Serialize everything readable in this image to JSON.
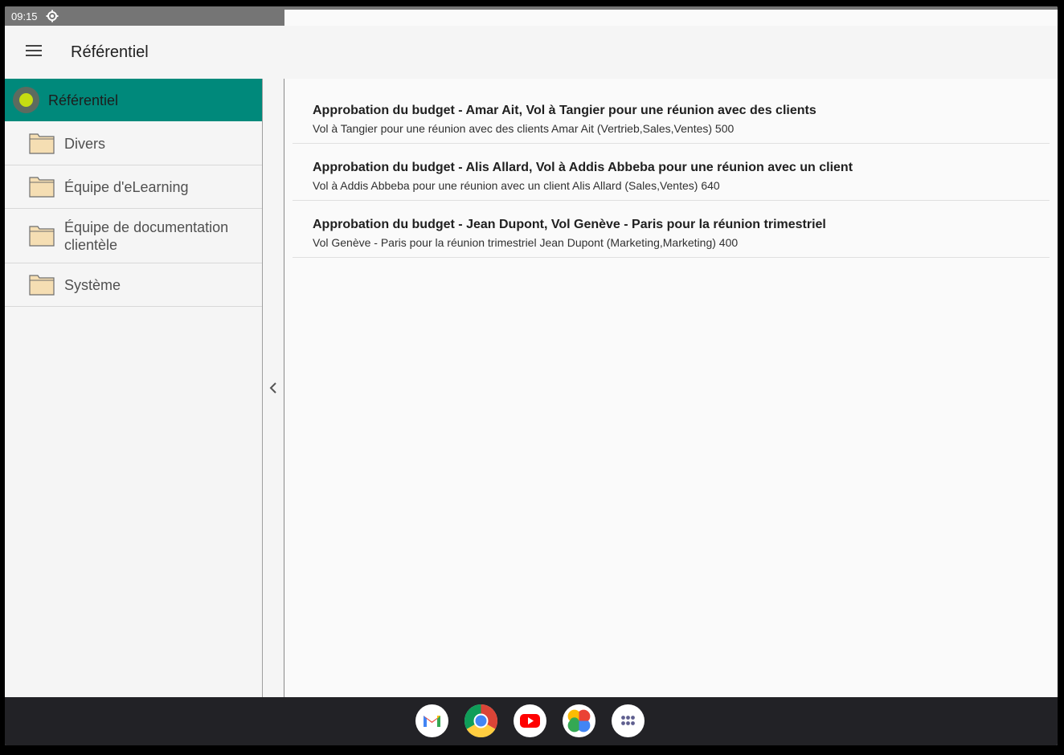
{
  "status": {
    "time": "09:15"
  },
  "appbar": {
    "title": "Référentiel"
  },
  "tree": {
    "root": "Référentiel",
    "folders": [
      "Divers",
      "Équipe d'eLearning",
      "Équipe de documentation clientèle",
      "Système"
    ]
  },
  "items": [
    {
      "title": "Approbation du budget - Amar Ait, Vol à Tangier pour une réunion avec des clients",
      "subtitle": "Vol à Tangier pour une réunion avec des clients Amar Ait (Vertrieb,Sales,Ventes) 500"
    },
    {
      "title": "Approbation du budget - Alis Allard, Vol à Addis Abbeba pour une réunion avec un client",
      "subtitle": "Vol à Addis Abbeba pour une réunion avec un client Alis Allard (Sales,Ventes) 640"
    },
    {
      "title": "Approbation du budget - Jean Dupont, Vol Genève - Paris pour la réunion trimestriel",
      "subtitle": "Vol Genève - Paris pour la réunion trimestriel Jean Dupont (Marketing,Marketing) 400"
    }
  ],
  "dock": [
    "gmail-icon",
    "chrome-icon",
    "youtube-icon",
    "photos-icon",
    "apps-icon"
  ],
  "colors": {
    "accent": "#00897b",
    "dot": "#c6dd12",
    "folder": "#f5deb3"
  }
}
